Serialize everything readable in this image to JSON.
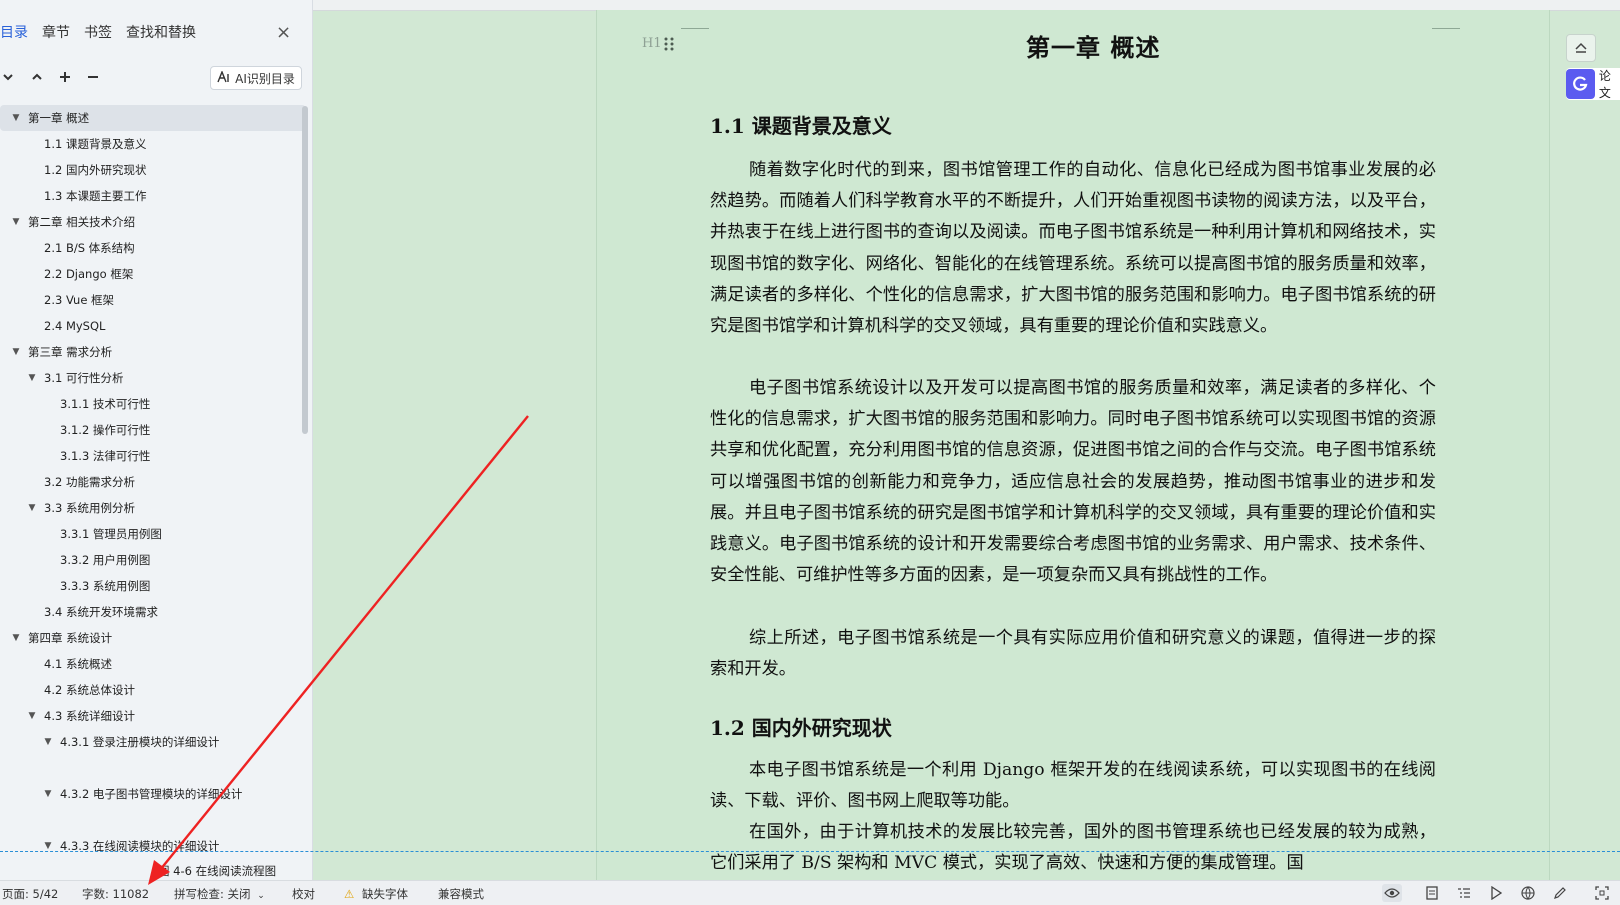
{
  "nav": {
    "tabs": [
      "目录",
      "章节",
      "书签",
      "查找和替换"
    ],
    "close_icon": "×",
    "ai_button": "AI识别目录",
    "outline": [
      {
        "level": 0,
        "caret": true,
        "label": "第一章  概述",
        "selected": true
      },
      {
        "level": 1,
        "caret": false,
        "label": "1.1  课题背景及意义"
      },
      {
        "level": 1,
        "caret": false,
        "label": "1.2  国内外研究现状"
      },
      {
        "level": 1,
        "caret": false,
        "label": "1.3  本课题主要工作"
      },
      {
        "level": 0,
        "caret": true,
        "label": "第二章  相关技术介绍"
      },
      {
        "level": 1,
        "caret": false,
        "label": "2.1 B/S 体系结构"
      },
      {
        "level": 1,
        "caret": false,
        "label": "2.2 Django 框架"
      },
      {
        "level": 1,
        "caret": false,
        "label": "2.3 Vue 框架"
      },
      {
        "level": 1,
        "caret": false,
        "label": "2.4 MySQL"
      },
      {
        "level": 0,
        "caret": true,
        "label": "第三章  需求分析"
      },
      {
        "level": 1,
        "caret": true,
        "label": "3.1  可行性分析"
      },
      {
        "level": 2,
        "caret": false,
        "label": "3.1.1  技术可行性"
      },
      {
        "level": 2,
        "caret": false,
        "label": "3.1.2  操作可行性"
      },
      {
        "level": 2,
        "caret": false,
        "label": "3.1.3  法律可行性"
      },
      {
        "level": 1,
        "caret": false,
        "label": "3.2  功能需求分析"
      },
      {
        "level": 1,
        "caret": true,
        "label": "3.3  系统用例分析"
      },
      {
        "level": 2,
        "caret": false,
        "label": "3.3.1  管理员用例图"
      },
      {
        "level": 2,
        "caret": false,
        "label": "3.3.2  用户用例图"
      },
      {
        "level": 2,
        "caret": false,
        "label": "3.3.3  系统用例图"
      },
      {
        "level": 1,
        "caret": false,
        "label": "3.4 系统开发环境需求"
      },
      {
        "level": 0,
        "caret": true,
        "label": "第四章  系统设计"
      },
      {
        "level": 1,
        "caret": false,
        "label": "4.1  系统概述"
      },
      {
        "level": 1,
        "caret": false,
        "label": "4.2  系统总体设计"
      },
      {
        "level": 1,
        "caret": true,
        "label": "4.3  系统详细设计"
      },
      {
        "level": 2,
        "caret": true,
        "label": "4.3.1  登录注册模块的详细设计",
        "gap_after": true
      },
      {
        "level": 2,
        "caret": true,
        "label": "4.3.2  电子图书管理模块的详细设计",
        "gap_after": true
      },
      {
        "level": 2,
        "caret": true,
        "label": "4.3.3  在线阅读模块的详细设计"
      },
      {
        "level": 3,
        "caret": false,
        "label": "图 4-6  在线阅读流程图"
      }
    ]
  },
  "doc": {
    "h1_marker": "H1",
    "chapter_title": "第一章  概述",
    "section1_title": "1.1  课题背景及意义",
    "section1_paragraphs": [
      "随着数字化时代的到来，图书馆管理工作的自动化、信息化已经成为图书馆事业发展的必然趋势。而随着人们科学教育水平的不断提升，人们开始重视图书读物的阅读方法，以及平台，并热衷于在线上进行图书的查询以及阅读。而电子图书馆系统是一种利用计算机和网络技术，实现图书馆的数字化、网络化、智能化的在线管理系统。系统可以提高图书馆的服务质量和效率，满足读者的多样化、个性化的信息需求，扩大图书馆的服务范围和影响力。电子图书馆系统的研究是图书馆学和计算机科学的交叉领域，具有重要的理论价值和实践意义。",
      "电子图书馆系统设计以及开发可以提高图书馆的服务质量和效率，满足读者的多样化、个性化的信息需求，扩大图书馆的服务范围和影响力。同时电子图书馆系统可以实现图书馆的资源共享和优化配置，充分利用图书馆的信息资源，促进图书馆之间的合作与交流。电子图书馆系统可以增强图书馆的创新能力和竞争力，适应信息社会的发展趋势，推动图书馆事业的进步和发展。并且电子图书馆系统的研究是图书馆学和计算机科学的交叉领域，具有重要的理论价值和实践意义。电子图书馆系统的设计和开发需要综合考虑图书馆的业务需求、用户需求、技术条件、安全性能、可维护性等多方面的因素，是一项复杂而又具有挑战性的工作。",
      "综上所述，电子图书馆系统是一个具有实际应用价值和研究意义的课题，值得进一步的探索和开发。"
    ],
    "section2_title": "1.2  国内外研究现状",
    "section2_paragraphs": [
      "本电子图书馆系统是一个利用 Django 框架开发的在线阅读系统，可以实现图书的在线阅读、下载、评价、图书网上爬取等功能。",
      "在国外，由于计算机技术的发展比较完善，国外的图书管理系统也已经发展的较为成熟，它们采用了 B/S 架构和 MVC 模式，实现了高效、快速和方便的集成管理。国"
    ]
  },
  "rail": {
    "paper_label": "论文"
  },
  "status": {
    "page": "页面: 5/42",
    "words": "字数: 11082",
    "spell": "拼写检查: 关闭",
    "proof": "校对",
    "missing_font": "缺失字体",
    "compat": "兼容模式"
  },
  "colors": {
    "page_bg": "#cfe8d2",
    "accent": "#2a62d9",
    "arrow": "#ee2222"
  }
}
